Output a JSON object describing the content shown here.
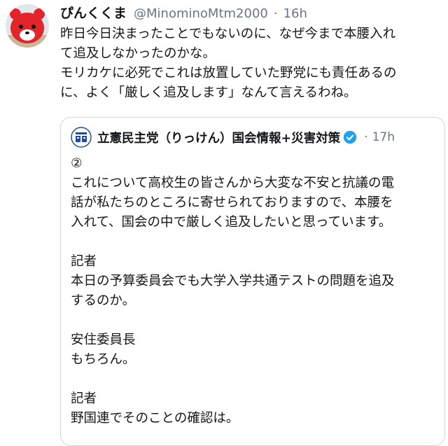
{
  "tweet": {
    "display_name": "ぴんくくま",
    "handle": "@MinominoMtm2000",
    "separator": "·",
    "time": "16h",
    "text_lines": [
      "昨日今日決まったことでもないのに、なぜ今まで本腰入れ",
      "て追及しなかったのかな。",
      "モリカケに必死でこれは放置していた野党にも責任あるの",
      "に、よく「厳しく追及します」なんて言えるわね。"
    ]
  },
  "quoted": {
    "display_name": "立憲民主党（りっけん）国会情報+災害対策",
    "separator": "·",
    "time": "17h",
    "lines": [
      "②",
      "これについて高校生の皆さんから大変な不安と抗議の電",
      "話が私たちのところに寄せられておりますので、本腰を",
      "入れて、国会の中で厳しく追及したいと思っています。",
      "",
      "記者",
      "本日の予算委員会でも大学入学共通テストの問題を追及",
      "するのか。",
      "",
      "安住委員長",
      "もちろん。",
      "",
      "記者",
      "野国連でそのことの確認は。"
    ]
  },
  "colors": {
    "text": "#14171a",
    "secondary": "#657786",
    "border": "#ccd6dd",
    "verified": "#1da1f2",
    "party_blue": "#1b4ea0"
  },
  "icons": {
    "avatar": "pink-bear-avatar",
    "quoted_avatar": "party-logo-avatar",
    "verified": "verified-badge-icon"
  }
}
